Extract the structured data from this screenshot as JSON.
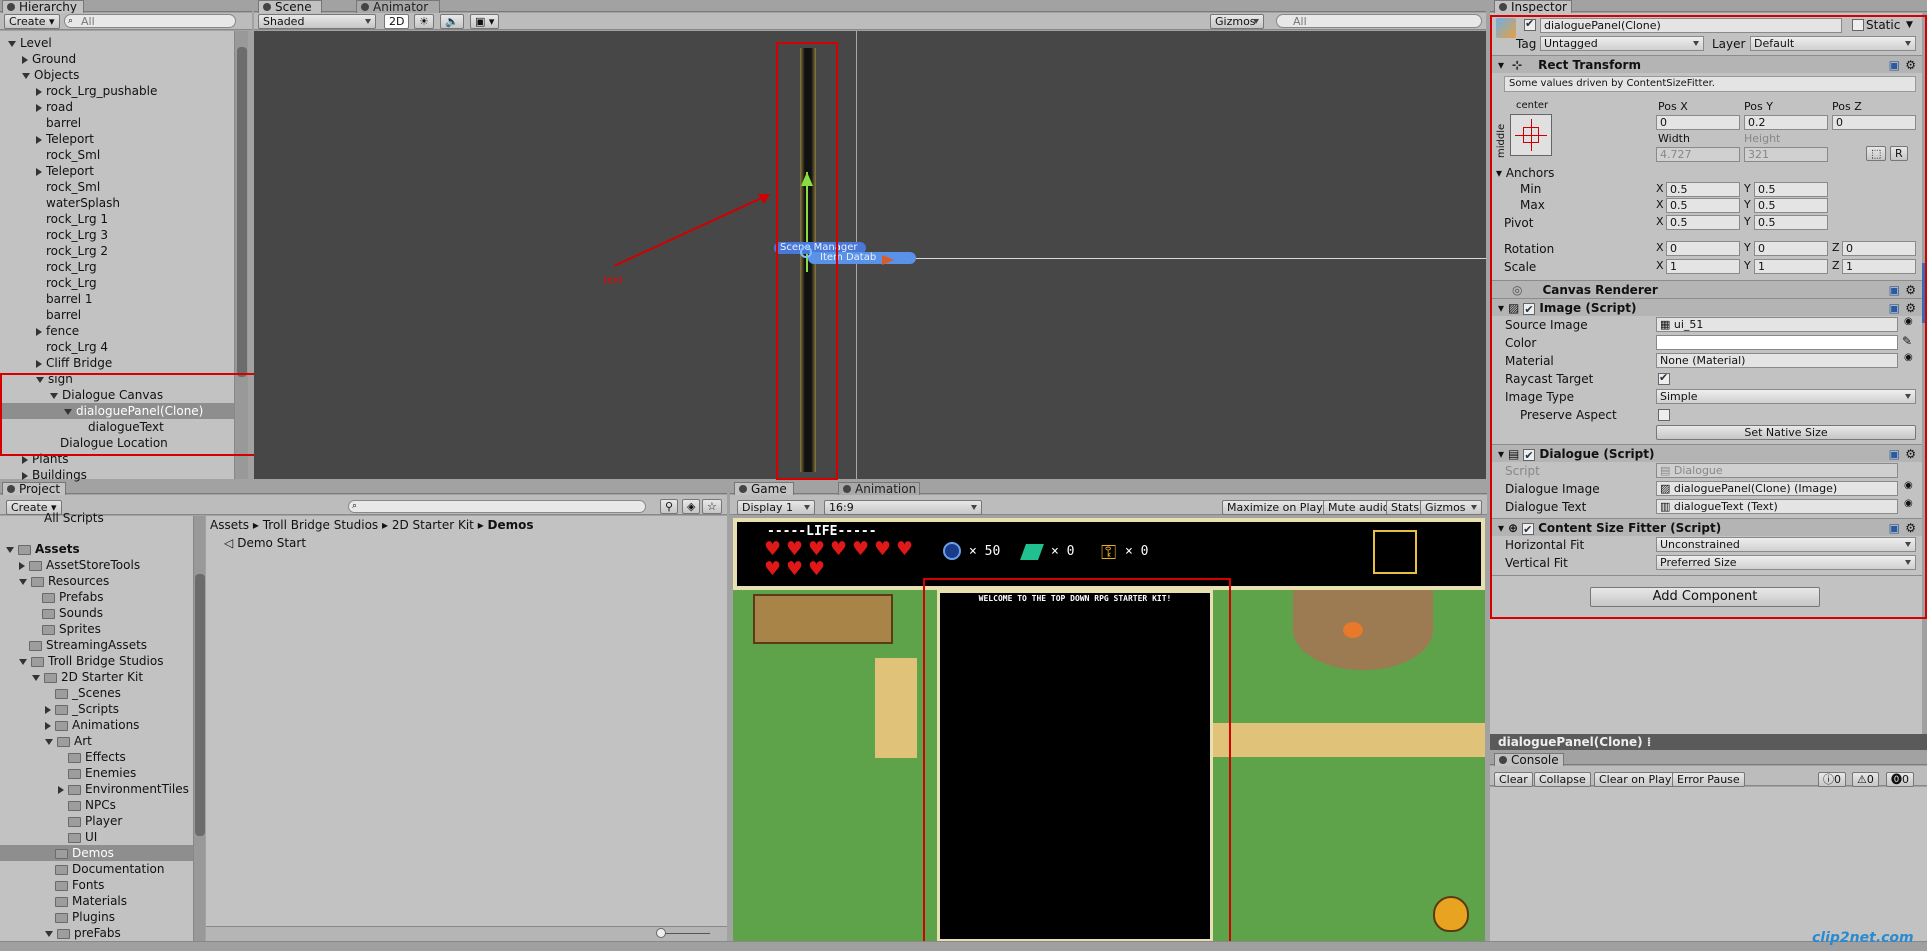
{
  "hierarchy": {
    "tab": "Hierarchy",
    "create": "Create",
    "search_placeholder": "All",
    "items": [
      {
        "label": "Level",
        "indent": 0,
        "arrow": "d"
      },
      {
        "label": "Ground",
        "indent": 1,
        "arrow": "r"
      },
      {
        "label": "Objects",
        "indent": 1,
        "arrow": "d"
      },
      {
        "label": "rock_Lrg_pushable",
        "indent": 2,
        "arrow": "r"
      },
      {
        "label": "road",
        "indent": 2,
        "arrow": "r"
      },
      {
        "label": "barrel",
        "indent": 2,
        "arrow": ""
      },
      {
        "label": "Teleport",
        "indent": 2,
        "arrow": "r"
      },
      {
        "label": "rock_Sml",
        "indent": 2,
        "arrow": ""
      },
      {
        "label": "Teleport",
        "indent": 2,
        "arrow": "r"
      },
      {
        "label": "rock_Sml",
        "indent": 2,
        "arrow": ""
      },
      {
        "label": "waterSplash",
        "indent": 2,
        "arrow": ""
      },
      {
        "label": "rock_Lrg 1",
        "indent": 2,
        "arrow": ""
      },
      {
        "label": "rock_Lrg 3",
        "indent": 2,
        "arrow": ""
      },
      {
        "label": "rock_Lrg 2",
        "indent": 2,
        "arrow": ""
      },
      {
        "label": "rock_Lrg",
        "indent": 2,
        "arrow": ""
      },
      {
        "label": "rock_Lrg",
        "indent": 2,
        "arrow": ""
      },
      {
        "label": "barrel 1",
        "indent": 2,
        "arrow": ""
      },
      {
        "label": "barrel",
        "indent": 2,
        "arrow": ""
      },
      {
        "label": "fence",
        "indent": 2,
        "arrow": "r"
      },
      {
        "label": "rock_Lrg 4",
        "indent": 2,
        "arrow": ""
      },
      {
        "label": "Cliff Bridge",
        "indent": 2,
        "arrow": "r"
      },
      {
        "label": "sign",
        "indent": 2,
        "arrow": "d"
      },
      {
        "label": "Dialogue Canvas",
        "indent": 3,
        "arrow": "d"
      },
      {
        "label": "dialoguePanel(Clone)",
        "indent": 4,
        "arrow": "d",
        "selected": true
      },
      {
        "label": "dialogueText",
        "indent": 5,
        "arrow": ""
      },
      {
        "label": "Dialogue Location",
        "indent": 3,
        "arrow": ""
      },
      {
        "label": "Plants",
        "indent": 1,
        "arrow": "r"
      },
      {
        "label": "Buildings",
        "indent": 1,
        "arrow": "r"
      }
    ]
  },
  "scene": {
    "tab_scene": "Scene",
    "tab_animator": "Animator",
    "shading": "Shaded",
    "mode_2d": "2D",
    "gizmos": "Gizmos",
    "search_placeholder": "All",
    "label_scene_manager": "Scene Manager",
    "label_item_db": "Item Datab",
    "annotation": "text"
  },
  "project": {
    "tab": "Project",
    "create": "Create",
    "favorite": "All Scripts",
    "breadcrumb": [
      "Assets",
      "Troll Bridge Studios",
      "2D Starter Kit",
      "Demos"
    ],
    "file": "Demo Start",
    "tree": [
      {
        "label": "Assets",
        "indent": 0,
        "arrow": "d",
        "bold": true
      },
      {
        "label": "AssetStoreTools",
        "indent": 1,
        "arrow": "r"
      },
      {
        "label": "Resources",
        "indent": 1,
        "arrow": "d"
      },
      {
        "label": "Prefabs",
        "indent": 2,
        "arrow": ""
      },
      {
        "label": "Sounds",
        "indent": 2,
        "arrow": ""
      },
      {
        "label": "Sprites",
        "indent": 2,
        "arrow": ""
      },
      {
        "label": "StreamingAssets",
        "indent": 1,
        "arrow": ""
      },
      {
        "label": "Troll Bridge Studios",
        "indent": 1,
        "arrow": "d"
      },
      {
        "label": "2D Starter Kit",
        "indent": 2,
        "arrow": "d"
      },
      {
        "label": "_Scenes",
        "indent": 3,
        "arrow": ""
      },
      {
        "label": "_Scripts",
        "indent": 3,
        "arrow": "r"
      },
      {
        "label": "Animations",
        "indent": 3,
        "arrow": "r"
      },
      {
        "label": "Art",
        "indent": 3,
        "arrow": "d"
      },
      {
        "label": "Effects",
        "indent": 4,
        "arrow": ""
      },
      {
        "label": "Enemies",
        "indent": 4,
        "arrow": ""
      },
      {
        "label": "EnvironmentTiles",
        "indent": 4,
        "arrow": "r"
      },
      {
        "label": "NPCs",
        "indent": 4,
        "arrow": ""
      },
      {
        "label": "Player",
        "indent": 4,
        "arrow": ""
      },
      {
        "label": "UI",
        "indent": 4,
        "arrow": ""
      },
      {
        "label": "Demos",
        "indent": 3,
        "arrow": "",
        "selected": true
      },
      {
        "label": "Documentation",
        "indent": 3,
        "arrow": ""
      },
      {
        "label": "Fonts",
        "indent": 3,
        "arrow": ""
      },
      {
        "label": "Materials",
        "indent": 3,
        "arrow": ""
      },
      {
        "label": "Plugins",
        "indent": 3,
        "arrow": ""
      },
      {
        "label": "preFabs",
        "indent": 3,
        "arrow": "d"
      }
    ]
  },
  "game": {
    "tab_game": "Game",
    "tab_animation": "Animation",
    "display": "Display 1",
    "aspect": "16:9",
    "maximize": "Maximize on Play",
    "mute": "Mute audio",
    "stats": "Stats",
    "gizmos": "Gizmos",
    "life": "-----LIFE-----",
    "bombs": "× 50",
    "gems": "× 0",
    "keys": "× 0",
    "dialogue": "WELCOME TO THE TOP DOWN RPG STARTER KIT!",
    "hearts_full": 10
  },
  "inspector": {
    "tab": "Inspector",
    "object_name": "dialoguePanel(Clone)",
    "static": "Static",
    "tag_label": "Tag",
    "tag": "Untagged",
    "layer_label": "Layer",
    "layer": "Default",
    "rect": {
      "title": "Rect Transform",
      "note": "Some values driven by ContentSizeFitter.",
      "anchor_h": "center",
      "anchor_v": "middle",
      "posx_l": "Pos X",
      "posy_l": "Pos Y",
      "posz_l": "Pos Z",
      "posx": "0",
      "posy": "0.2",
      "posz": "0",
      "width_l": "Width",
      "height_l": "Height",
      "width": "4.727",
      "height": "321",
      "r": "R",
      "anchors": "Anchors",
      "min": "Min",
      "max": "Max",
      "pivot": "Pivot",
      "rotation": "Rotation",
      "scale": "Scale",
      "minx": "0.5",
      "miny": "0.5",
      "maxx": "0.5",
      "maxy": "0.5",
      "pivx": "0.5",
      "pivy": "0.5",
      "rotx": "0",
      "roty": "0",
      "rotz": "0",
      "scx": "1",
      "scy": "1",
      "scz": "1",
      "x": "X",
      "y": "Y",
      "z": "Z"
    },
    "canvas_renderer": "Canvas Renderer",
    "image": {
      "title": "Image (Script)",
      "source_l": "Source Image",
      "source": "ui_51",
      "color_l": "Color",
      "material_l": "Material",
      "material": "None (Material)",
      "raycast_l": "Raycast Target",
      "type_l": "Image Type",
      "type": "Simple",
      "preserve_l": "Preserve Aspect",
      "native": "Set Native Size"
    },
    "dialogue": {
      "title": "Dialogue (Script)",
      "script_l": "Script",
      "script": "Dialogue",
      "img_l": "Dialogue Image",
      "img": "dialoguePanel(Clone) (Image)",
      "txt_l": "Dialogue Text",
      "txt": "dialogueText (Text)"
    },
    "fitter": {
      "title": "Content Size Fitter (Script)",
      "h_l": "Horizontal Fit",
      "h": "Unconstrained",
      "v_l": "Vertical Fit",
      "v": "Preferred Size"
    },
    "add_component": "Add Component"
  },
  "preview": {
    "title": "dialoguePanel(Clone)"
  },
  "console": {
    "tab": "Console",
    "clear": "Clear",
    "collapse": "Collapse",
    "clear_on_play": "Clear on Play",
    "error_pause": "Error Pause",
    "c1": "0",
    "c2": "0",
    "c3": "0"
  },
  "watermark": "clip2net.com"
}
